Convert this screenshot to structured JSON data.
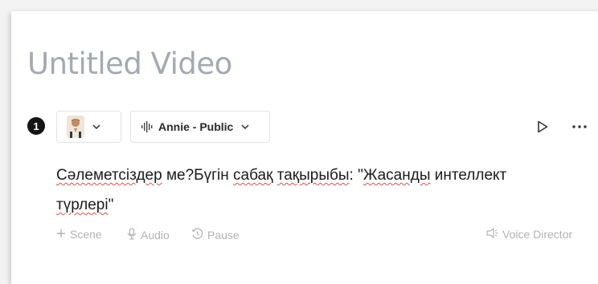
{
  "video": {
    "title": "Untitled Video"
  },
  "scene": {
    "number": "1",
    "avatar": {
      "icon": "avatar-portrait"
    },
    "voice": {
      "name": "Annie - Public",
      "icon": "waveform-icon"
    },
    "actions": {
      "play_icon": "play-icon",
      "more_icon": "more-icon"
    },
    "script": {
      "line1": [
        {
          "text": "Сәлеметсіздер",
          "spell": true
        },
        {
          "text": " ме?Бүгін ",
          "spell": false
        },
        {
          "text": "сабақ",
          "spell": true
        },
        {
          "text": " ",
          "spell": false
        },
        {
          "text": "тақырыбы",
          "spell": true
        },
        {
          "text": ": \"",
          "spell": false
        },
        {
          "text": "Жасанды",
          "spell": true
        },
        {
          "text": " интеллект",
          "spell": false
        }
      ],
      "line2": [
        {
          "text": "түрлері",
          "spell": true
        },
        {
          "text": "\"",
          "spell": false
        }
      ]
    },
    "toolbar": {
      "scene_label": "Scene",
      "audio_label": "Audio",
      "pause_label": "Pause",
      "voice_director_label": "Voice Director"
    }
  },
  "colors": {
    "title": "#a4aab3",
    "muted": "#b3b3b3",
    "badge": "#151515",
    "spellcheck": "#d9534f"
  }
}
